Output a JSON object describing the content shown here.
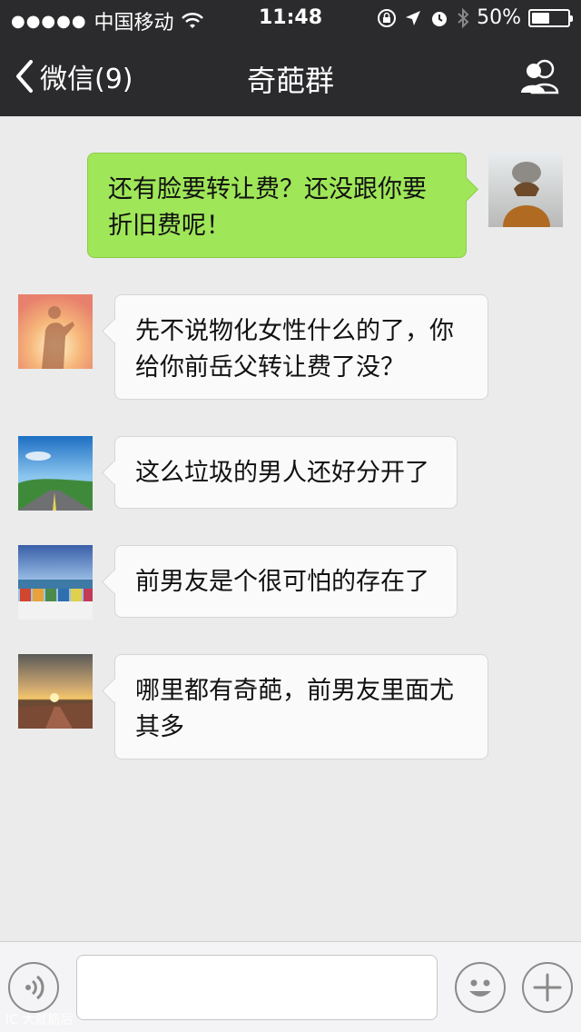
{
  "status_bar": {
    "signal": "●●●●●",
    "carrier": "中国移动",
    "time": "11:48",
    "battery": "50%",
    "battery_level": 0.5
  },
  "nav": {
    "back_label": "微信(9)",
    "title": "奇葩群"
  },
  "messages": [
    {
      "direction": "out",
      "text": "还有脸要转让费？还没跟你要折旧费呢！"
    },
    {
      "direction": "in",
      "text": "先不说物化女性什么的了，你给你前岳父转让费了没？"
    },
    {
      "direction": "in",
      "text": "这么垃圾的男人还好分开了"
    },
    {
      "direction": "in",
      "text": "前男友是个很可怕的存在了"
    },
    {
      "direction": "in",
      "text": "哪里都有奇葩，前男友里面尤其多"
    }
  ],
  "input": {
    "placeholder": ""
  },
  "watermark": "IC 大就筋后"
}
